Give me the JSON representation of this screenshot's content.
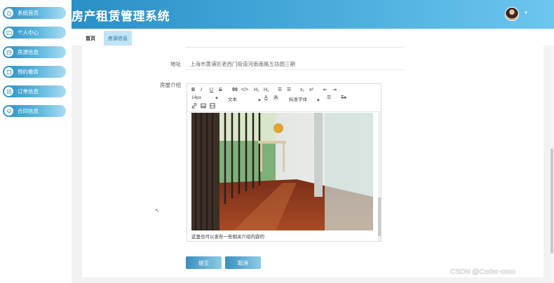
{
  "app": {
    "title": "房产租赁管理系统"
  },
  "sidebar": {
    "items": [
      {
        "label": "系统首页",
        "icon": "home-icon"
      },
      {
        "label": "个人中心",
        "icon": "id-card-icon"
      },
      {
        "label": "房源信息",
        "icon": "house-icon"
      },
      {
        "label": "预约看房",
        "icon": "calendar-icon"
      },
      {
        "label": "订单信息",
        "icon": "order-icon"
      },
      {
        "label": "合同信息",
        "icon": "contract-icon"
      }
    ]
  },
  "tabs": {
    "home": "首页",
    "active": "房源信息"
  },
  "form": {
    "address_label": "地址",
    "address_value": "上海市黄浦区老西门街道河南南路五坊园三期",
    "intro_label": "房屋介绍",
    "intro_caption": "这里也可以发布一些相关介绍内容的"
  },
  "editor": {
    "buttons": {
      "bold": "B",
      "italic": "I",
      "underline": "U",
      "strike": "S",
      "quote": "99",
      "code": "</>",
      "h1": "H₁",
      "h2": "H₂",
      "sub": "x₂",
      "sup": "x²",
      "clear": "Tx"
    },
    "font_size": "14px",
    "block_type": "文本",
    "font_family": "标准字体",
    "color_label": "A",
    "bg_label": "A"
  },
  "actions": {
    "submit": "提交",
    "cancel": "取消"
  },
  "watermark": "CSDN @Coder-coco",
  "colors": {
    "header": "#3aa3d6",
    "sidebar_item": "#3f9fcf",
    "active_tab": "#bfe4f6"
  }
}
